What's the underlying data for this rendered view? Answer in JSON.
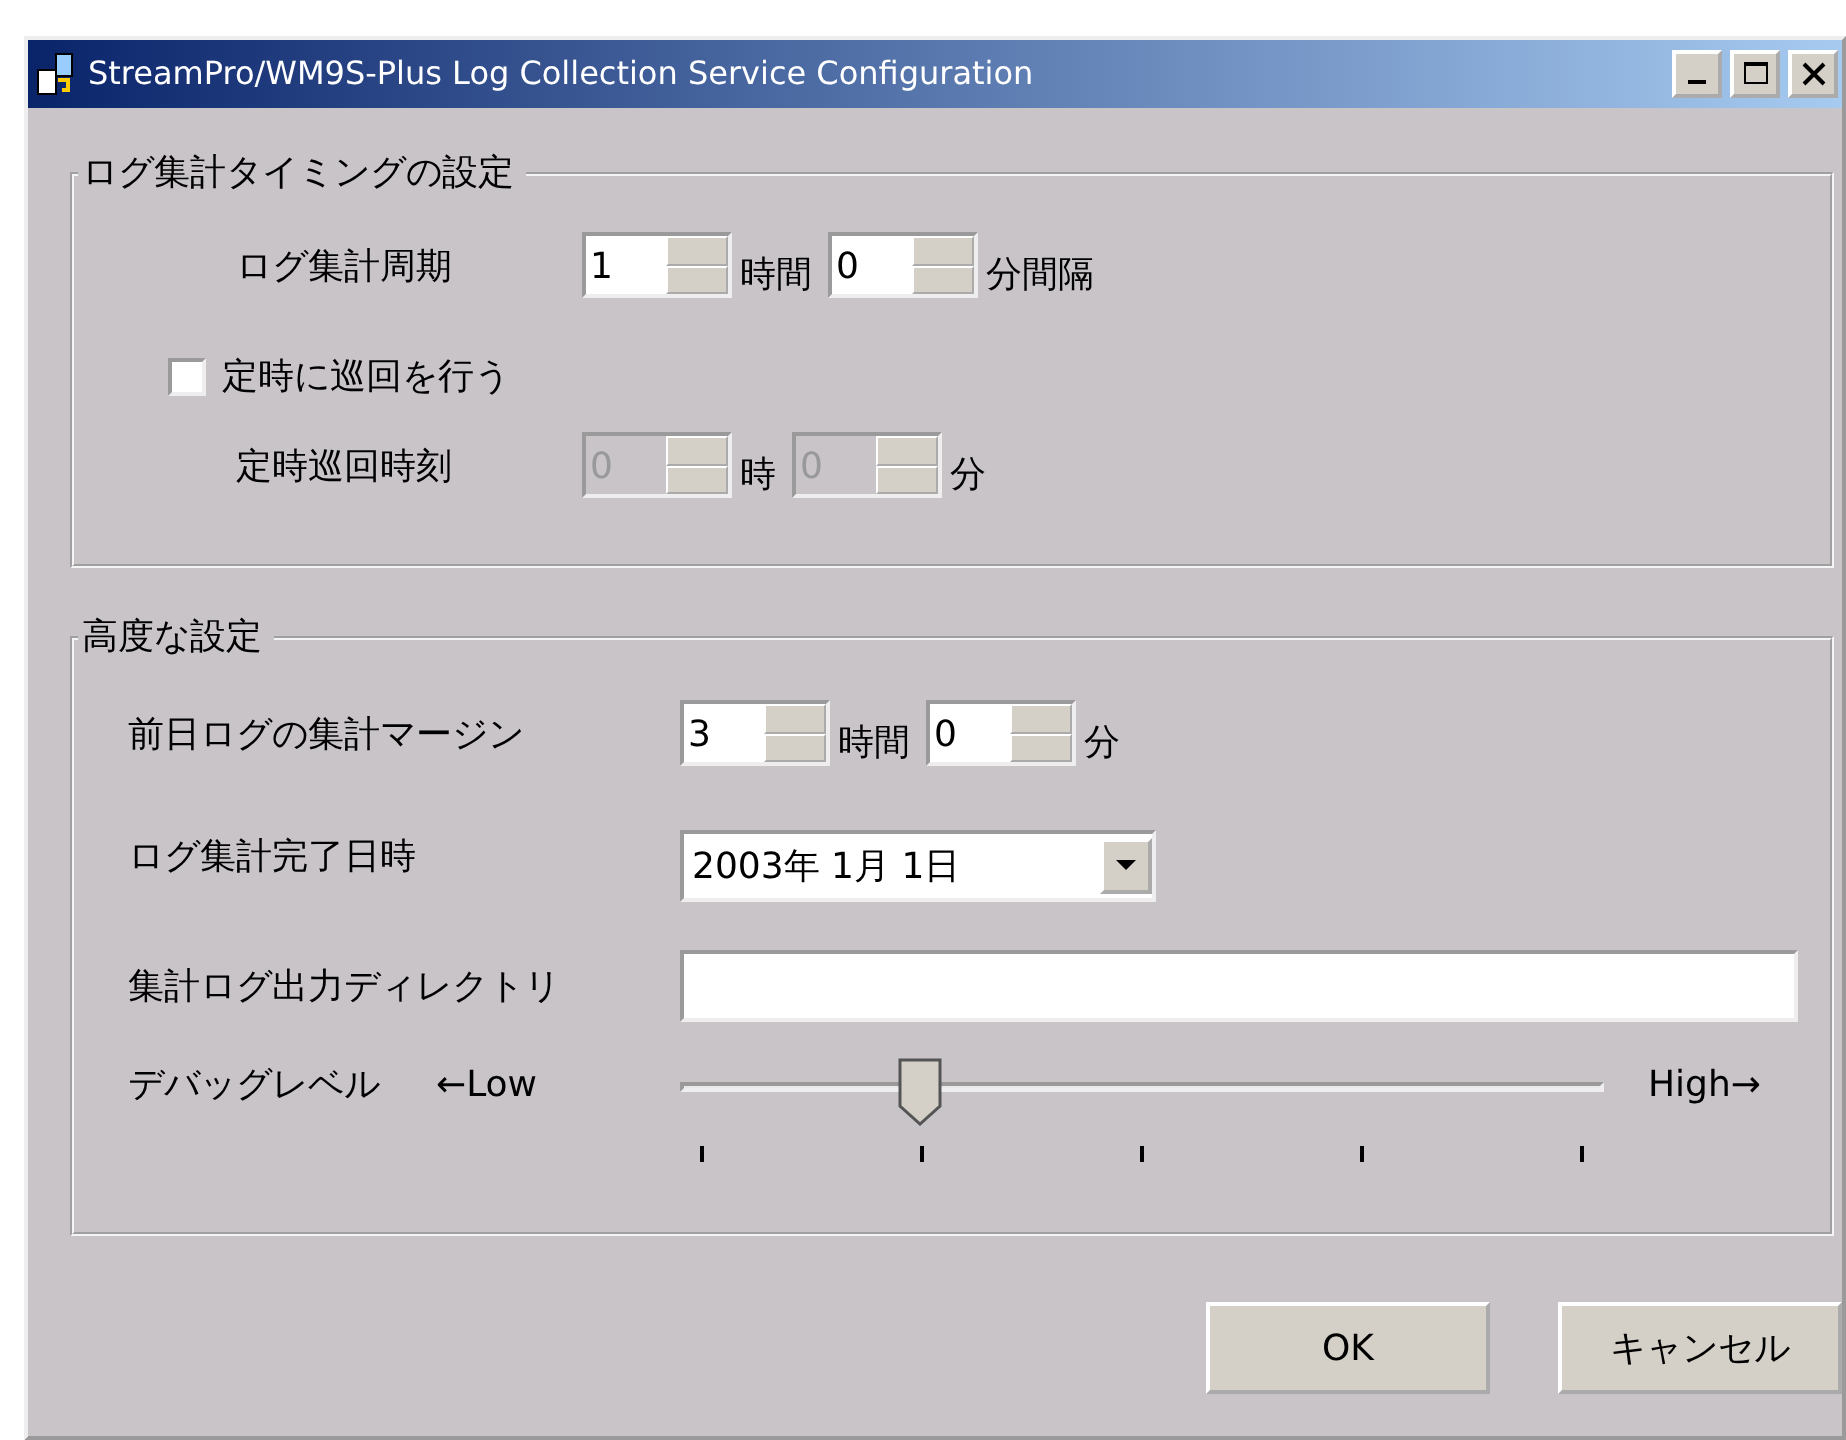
{
  "window": {
    "title": "StreamPro/WM9S-Plus Log Collection Service Configuration"
  },
  "timing_group": {
    "title": "ログ集計タイミングの設定",
    "period": {
      "label": "ログ集計周期",
      "hours": {
        "value": "1",
        "disabled": false
      },
      "hours_unit": "時間",
      "minutes": {
        "value": "0",
        "disabled": false
      },
      "minutes_unit": "分間隔"
    },
    "scheduled": {
      "label": "定時に巡回を行う",
      "checked": false
    },
    "scheduled_time": {
      "label": "定時巡回時刻",
      "hours": {
        "value": "0",
        "disabled": true
      },
      "hours_unit": "時",
      "minutes": {
        "value": "0",
        "disabled": true
      },
      "minutes_unit": "分"
    }
  },
  "advanced_group": {
    "title": "高度な設定",
    "margin": {
      "label": "前日ログの集計マージン",
      "hours": {
        "value": "3",
        "disabled": false
      },
      "hours_unit": "時間",
      "minutes": {
        "value": "0",
        "disabled": false
      },
      "minutes_unit": "分"
    },
    "completed": {
      "label": "ログ集計完了日時",
      "value": "2003年 1月 1日"
    },
    "output_dir": {
      "label": "集計ログ出力ディレクトリ"
    },
    "debug": {
      "label": "デバッグレベル",
      "low_label": "←Low",
      "high_label": "High→",
      "level": 0.25
    }
  },
  "buttons": [
    "OK",
    "キャンセル"
  ]
}
